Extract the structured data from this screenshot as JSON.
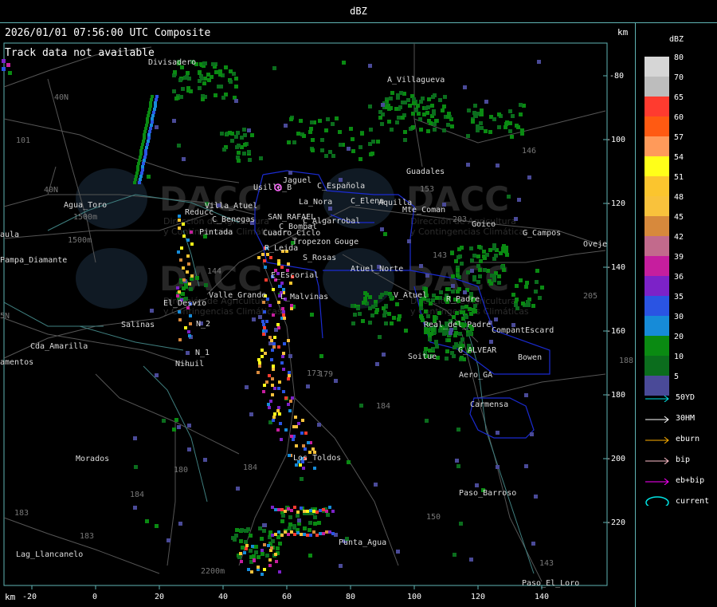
{
  "window": {
    "title": "dBZ"
  },
  "header": {
    "timestamp": "2026/01/01 07:56:00 UTC Composite",
    "track_status": "Track data not available",
    "km_unit_top": "km",
    "km_unit_bottom": "km"
  },
  "axes": {
    "x_ticks": [
      "-20",
      "0",
      "20",
      "40",
      "60",
      "80",
      "100",
      "120",
      "140"
    ],
    "y_ticks": [
      "-80",
      "-100",
      "-120",
      "-140",
      "-160",
      "-180",
      "-200",
      "-220"
    ]
  },
  "watermark": {
    "brand": "DACC",
    "line1": "Dirección de Agricultura",
    "line2": "y Contingencias Climáticas"
  },
  "places": [
    {
      "name": "Divisadero"
    },
    {
      "name": "A_Villaguevа"
    },
    {
      "name": "Guadales"
    },
    {
      "name": "Usilla_B"
    },
    {
      "name": "Jaguel"
    },
    {
      "name": "C_Española"
    },
    {
      "name": "La_Nora"
    },
    {
      "name": "C_Elena"
    },
    {
      "name": "Aquilla"
    },
    {
      "name": "Mte_Coman"
    },
    {
      "name": "Goico"
    },
    {
      "name": "G_Campos"
    },
    {
      "name": "Agua_Toro"
    },
    {
      "name": "Reducc"
    },
    {
      "name": "Villa_Atuel"
    },
    {
      "name": "C_Benegas"
    },
    {
      "name": "SAN_RAFAEL"
    },
    {
      "name": "C_Algarrobal"
    },
    {
      "name": "C_Bombal"
    },
    {
      "name": "Pintada"
    },
    {
      "name": "Tropezon"
    },
    {
      "name": "Gouge"
    },
    {
      "name": "Cuadro_Ciclo"
    },
    {
      "name": "R_Leida"
    },
    {
      "name": "S_Rosas"
    },
    {
      "name": "Atuel_Norte"
    },
    {
      "name": "Pampa_Diamante"
    },
    {
      "name": "E_Escorial"
    },
    {
      "name": "El_Desvio"
    },
    {
      "name": "Valle_Grande"
    },
    {
      "name": "L_Malvinas"
    },
    {
      "name": "V_Atuel"
    },
    {
      "name": "R_Padre"
    },
    {
      "name": "N_2"
    },
    {
      "name": "Salinas"
    },
    {
      "name": "Real_del_Padre"
    },
    {
      "name": "CompantEscard"
    },
    {
      "name": "G_ALVEAR"
    },
    {
      "name": "Soitue"
    },
    {
      "name": "Bowen"
    },
    {
      "name": "N_1"
    },
    {
      "name": "Nihuil"
    },
    {
      "name": "Cda_Amarilla"
    },
    {
      "name": "amentos"
    },
    {
      "name": "Aero_GA"
    },
    {
      "name": "Carmensa"
    },
    {
      "name": "Morados"
    },
    {
      "name": "Los_Toldos"
    },
    {
      "name": "Paso_Barroso"
    },
    {
      "name": "Punta_Agua"
    },
    {
      "name": "Lag_Llancanelo"
    },
    {
      "name": "Paso_El_Loro"
    },
    {
      "name": "aula"
    },
    {
      "name": "Oveje"
    }
  ],
  "road_numbers": [
    "40N",
    "101",
    "40N",
    "144",
    "146",
    "153",
    "203",
    "143",
    "173",
    "184",
    "180",
    "184",
    "150",
    "184",
    "183",
    "205",
    "183",
    "143",
    "179",
    "188",
    "5N",
    "1500m",
    "2200m",
    "1500m"
  ],
  "legend": {
    "title": "dBZ",
    "scale": [
      {
        "value": "80",
        "color": "#d6d6d6"
      },
      {
        "value": "70",
        "color": "#bdbdbd"
      },
      {
        "value": "65",
        "color": "#ff3b2f"
      },
      {
        "value": "60",
        "color": "#ff5a12"
      },
      {
        "value": "57",
        "color": "#ff9a5a"
      },
      {
        "value": "54",
        "color": "#ffff19"
      },
      {
        "value": "51",
        "color": "#fbc52e"
      },
      {
        "value": "48",
        "color": "#f9c23c"
      },
      {
        "value": "45",
        "color": "#d7893c"
      },
      {
        "value": "42",
        "color": "#c26a8c"
      },
      {
        "value": "39",
        "color": "#c61e9e"
      },
      {
        "value": "36",
        "color": "#7c22c8"
      },
      {
        "value": "35",
        "color": "#2a54e3"
      },
      {
        "value": "30",
        "color": "#168bd8"
      },
      {
        "value": "20",
        "color": "#0a8a12"
      },
      {
        "value": "10",
        "color": "#0b6d1d"
      },
      {
        "value": "5",
        "color": "#4a4a98"
      }
    ],
    "tracks": [
      {
        "label": "50YD",
        "color": "#00e5e5"
      },
      {
        "label": "30HM",
        "color": "#ffffff"
      },
      {
        "label": "eburn",
        "color": "#ffb000"
      },
      {
        "label": "bip",
        "color": "#ffc0cb"
      },
      {
        "label": "eb+bip",
        "color": "#ff00ff"
      },
      {
        "label": "current",
        "color": "#00e5e5"
      }
    ]
  }
}
